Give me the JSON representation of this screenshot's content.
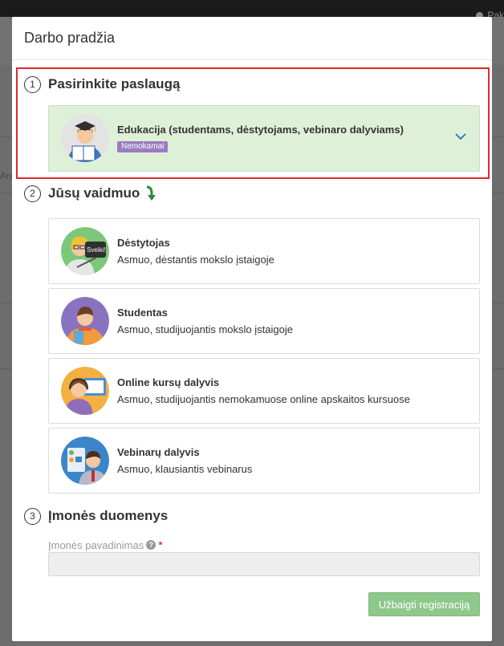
{
  "background": {
    "user_label": "Pak",
    "left_text": "Arc"
  },
  "modal": {
    "title": "Darbo pradžia"
  },
  "steps": [
    {
      "number": "1",
      "title": "Pasirinkite paslaugą"
    },
    {
      "number": "2",
      "title": "Jūsų vaidmuo"
    },
    {
      "number": "3",
      "title": "Įmonės duomenys"
    }
  ],
  "service": {
    "title": "Edukacija (studentams, dėstytojams, vebinaro dalyviams)",
    "badge": "Nemokamai",
    "icon": "chevron-down-icon"
  },
  "roles": [
    {
      "title": "Dėstytojas",
      "desc": "Asmuo, dėstantis mokslo įstaigoje",
      "avatar_text": "Sveiki!"
    },
    {
      "title": "Studentas",
      "desc": "Asmuo, studijuojantis mokslo įstaigoje"
    },
    {
      "title": "Online kursų dalyvis",
      "desc": "Asmuo, studijuojantis nemokamuose online apskaitos kursuose"
    },
    {
      "title": "Vebinarų dalyvis",
      "desc": "Asmuo, klausiantis vebinarus"
    }
  ],
  "company": {
    "name_label": "Įmonės pavadinimas",
    "help": "?",
    "required_mark": "*",
    "name_value": ""
  },
  "submit_label": "Užbaigti registraciją",
  "colors": {
    "selected_bg": "#dff0d8",
    "highlight": "#e0282e",
    "badge": "#9b7cc2",
    "submit": "#8ec88b",
    "chevron": "#3a7bbf"
  }
}
